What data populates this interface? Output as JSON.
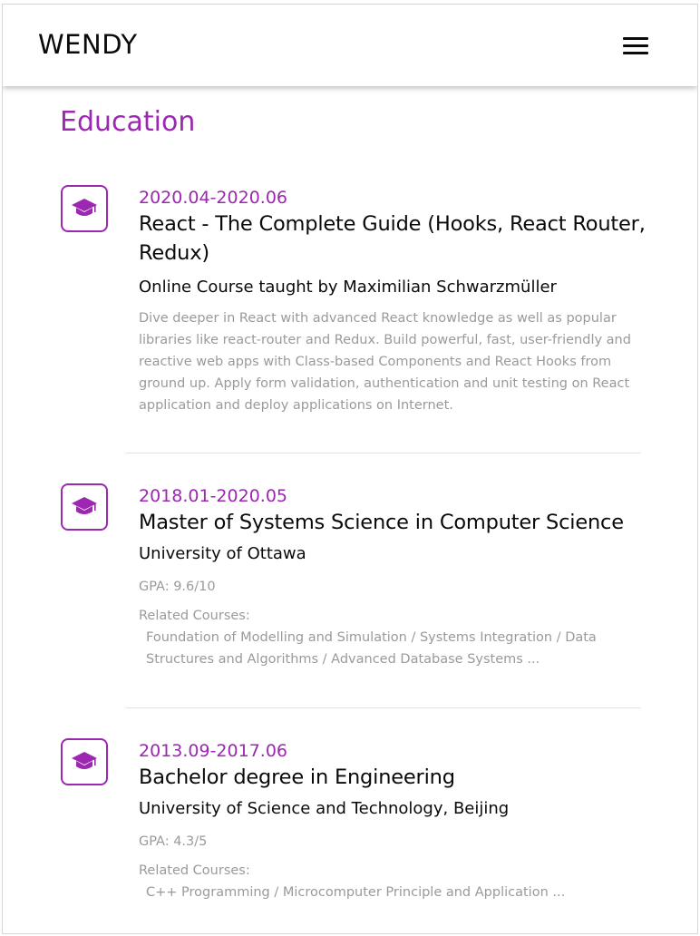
{
  "header": {
    "logo": "WENDY",
    "menu_icon": "hamburger-menu-icon"
  },
  "section": {
    "title": "Education"
  },
  "entries": [
    {
      "icon": "graduation-cap-icon",
      "date": "2020.04-2020.06",
      "title": "React - The Complete Guide (Hooks, React Router, Redux)",
      "org": "Online Course taught by Maximilian Schwarzmüller",
      "description": "Dive deeper in React with advanced React knowledge as well as popular libraries like react-router and Redux. Build powerful, fast, user-friendly and reactive web apps with Class-based Components and React Hooks from ground up. Apply form validation, authentication and unit testing on React application and deploy applications on Internet."
    },
    {
      "icon": "graduation-cap-icon",
      "date": "2018.01-2020.05",
      "title": "Master of Systems Science in Computer Science",
      "org": "University of Ottawa",
      "gpa": "GPA: 9.6/10",
      "courses_label": "Related Courses:",
      "courses": "Foundation of Modelling and Simulation / Systems Integration / Data Structures and Algorithms / Advanced Database Systems ..."
    },
    {
      "icon": "graduation-cap-icon",
      "date": "2013.09-2017.06",
      "title": "Bachelor degree in Engineering",
      "org": "University of Science and Technology, Beijing",
      "gpa": "GPA: 4.3/5",
      "courses_label": "Related Courses:",
      "courses": "C++ Programming / Microcomputer Principle and Application ..."
    }
  ],
  "colors": {
    "accent": "#9c27b0",
    "muted_text": "#9a9a9a",
    "divider": "#e2e2e2"
  }
}
